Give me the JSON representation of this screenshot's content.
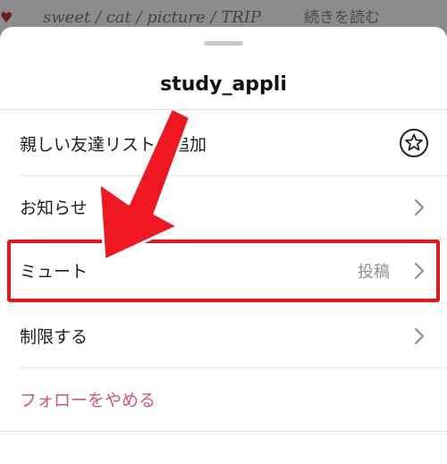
{
  "background": {
    "caption": "sweet / cat / picture / TRIP",
    "read_more": "続きを読む"
  },
  "sheet": {
    "title": "study_appli",
    "items": [
      {
        "label": "親しい友達リストに追加",
        "value": "",
        "icon": "star-circle-icon"
      },
      {
        "label": "お知らせ",
        "value": "",
        "icon": "chevron-right-icon"
      },
      {
        "label": "ミュート",
        "value": "投稿",
        "icon": "chevron-right-icon"
      },
      {
        "label": "制限する",
        "value": "",
        "icon": "chevron-right-icon"
      },
      {
        "label": "フォローをやめる",
        "value": "",
        "icon": ""
      }
    ]
  },
  "annotation": {
    "highlight_color": "#e8151b",
    "arrow_color": "#ef1820"
  }
}
